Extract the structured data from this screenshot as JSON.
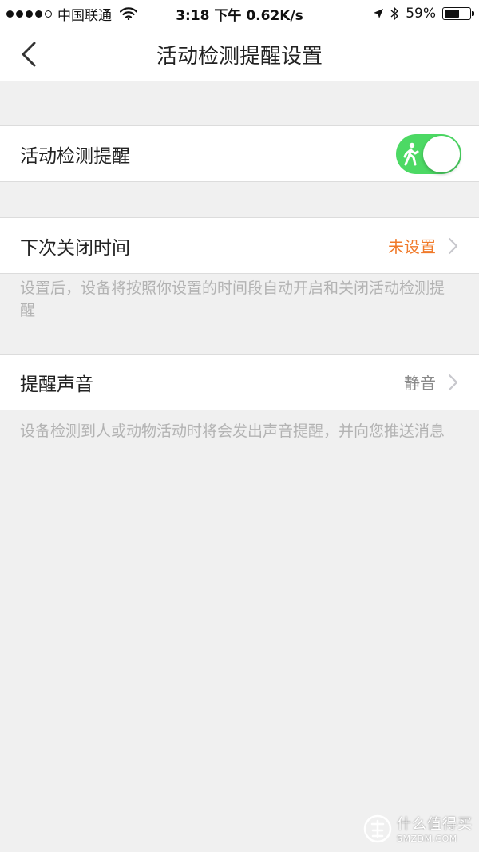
{
  "status_bar": {
    "carrier": "中国联通",
    "time_speed": "3:18 下午 0.62K/s",
    "battery_text": "59%",
    "battery_level": 0.59,
    "signal_bars": 4,
    "signal_total": 5
  },
  "navbar": {
    "title": "活动检测提醒设置",
    "back_icon": "chevron-left-icon"
  },
  "settings": {
    "activity_alert": {
      "label": "活动检测提醒",
      "enabled": true,
      "toggle_color": "#4cd964",
      "icon": "walking-person-icon"
    },
    "next_close_time": {
      "label": "下次关闭时间",
      "value": "未设置",
      "value_color": "#f07a2a",
      "hint": "设置后，设备将按照你设置的时间段自动开启和关闭活动检测提醒"
    },
    "alert_sound": {
      "label": "提醒声音",
      "value": "静音",
      "hint": "设备检测到人或动物活动时将会发出声音提醒，并向您推送消息"
    }
  },
  "watermark": {
    "text_cn": "什么值得买",
    "text_en": "SMZDM.COM"
  },
  "colors": {
    "background": "#f0f0f0",
    "row_bg": "#ffffff",
    "hint_text": "#b3b3b3",
    "accent_orange": "#f07a2a",
    "toggle_green": "#4cd964"
  }
}
